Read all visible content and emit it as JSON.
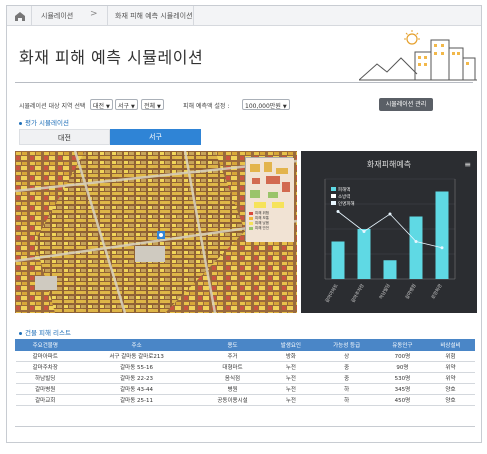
{
  "breadcrumb": {
    "home_icon": "home-icon",
    "item1": "시뮬레이션",
    "arrow": ">",
    "item2": "화재 피해 예측 시뮬레이션"
  },
  "header": {
    "title": "화재 피해 예측 시뮬레이션"
  },
  "filters": {
    "area_label": "시뮬레이션 대상 지역 선택",
    "city": "대전",
    "district": "서구",
    "scope": "전체",
    "amount_label": "피해 예측액 설정 :",
    "amount": "100,000만원",
    "manage_button": "시뮬레이션 관리"
  },
  "sections": {
    "results": "평가 시뮬레이션",
    "buildings": "건물 피해 리스트"
  },
  "tabs": [
    "대전",
    "서구"
  ],
  "map": {
    "legend": [
      "피해 위험",
      "피해 보통",
      "피해 낮음",
      "피해 안전"
    ],
    "colors": {
      "danger": "#d94a3b",
      "medium": "#f0b83a",
      "low": "#f6e35a",
      "safe": "#9ac46a"
    }
  },
  "chart_data": {
    "type": "bar",
    "title": "화재피해예측",
    "legend": [
      "피해액",
      "소방력",
      "인명피해"
    ],
    "legend_position": "top-left",
    "categories": [
      "갈마아파트",
      "갈마주차장",
      "하남빌딩",
      "갈마병원",
      "로앙화관"
    ],
    "series": [
      {
        "name": "피해액",
        "values": [
          30,
          40,
          15,
          50,
          70
        ]
      },
      {
        "name": "인명피해",
        "values": [
          54,
          38,
          52,
          30,
          25
        ]
      }
    ],
    "y_left_ticks": [
      "",
      "",
      "",
      "",
      ""
    ],
    "y_right_ticks": [
      "",
      "",
      "",
      "",
      ""
    ],
    "ylim": [
      0,
      80
    ],
    "grid": true
  },
  "table": {
    "headers": [
      "주요건물명",
      "주소",
      "용도",
      "발생요인",
      "가능성 등급",
      "유동인구",
      "비상설비"
    ],
    "rows": [
      [
        "갈마아파트",
        "서구 갈마동 갈마로213",
        "주거",
        "방화",
        "상",
        "700명",
        "위험"
      ],
      [
        "갈마주차장",
        "갈마동 55-16",
        "대형마트",
        "누전",
        "중",
        "90명",
        "위약"
      ],
      [
        "하남빌딩",
        "갈마동 22-23",
        "음식점",
        "누전",
        "중",
        "530명",
        "위약"
      ],
      [
        "갈마병원",
        "갈마동 43-44",
        "병원",
        "누전",
        "하",
        "345명",
        "양호"
      ],
      [
        "갈마교회",
        "갈마동 25-11",
        "공동이용시설",
        "누전",
        "하",
        "450명",
        "양호"
      ]
    ]
  }
}
